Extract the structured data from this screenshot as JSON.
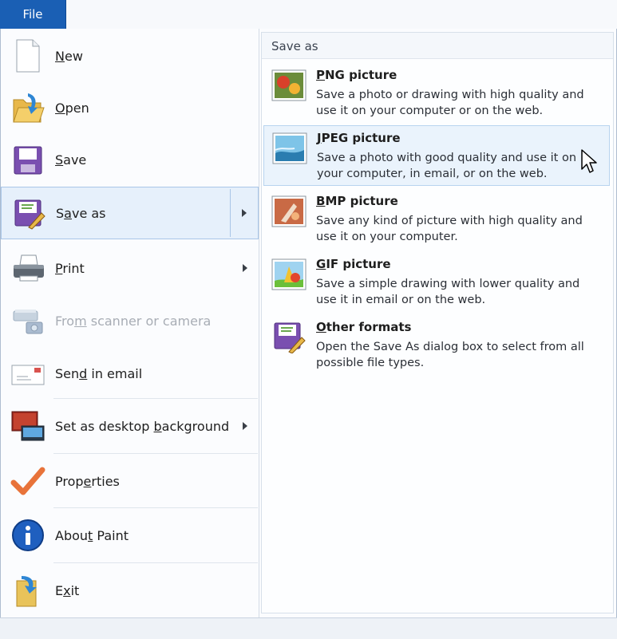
{
  "tab": {
    "file_label": "File"
  },
  "menu": {
    "items": [
      {
        "label": "New",
        "hotkey_letter": "N"
      },
      {
        "label": "Open",
        "hotkey_letter": "O"
      },
      {
        "label": "Save",
        "hotkey_letter": "S"
      },
      {
        "label": "Save as",
        "hotkey_letter": "a"
      },
      {
        "label": "Print",
        "hotkey_letter": "P"
      },
      {
        "label": "From scanner or camera",
        "hotkey_letter": "m"
      },
      {
        "label": "Send in email",
        "hotkey_letter": "d"
      },
      {
        "label": "Set as desktop background",
        "hotkey_letter": "b"
      },
      {
        "label": "Properties",
        "hotkey_letter": "e"
      },
      {
        "label": "About Paint",
        "hotkey_letter": "t"
      },
      {
        "label": "Exit",
        "hotkey_letter": "x"
      }
    ]
  },
  "save_as_panel": {
    "title": "Save as",
    "options": [
      {
        "title": "PNG picture",
        "desc": "Save a photo or drawing with high quality and use it on your computer or on the web."
      },
      {
        "title": "JPEG picture",
        "desc": "Save a photo with good quality and use it on your computer, in email, or on the web."
      },
      {
        "title": "BMP picture",
        "desc": "Save any kind of picture with high quality and use it on your computer."
      },
      {
        "title": "GIF picture",
        "desc": "Save a simple drawing with lower quality and use it in email or on the web."
      },
      {
        "title": "Other formats",
        "desc": "Open the Save As dialog box to select from all possible file types."
      }
    ]
  },
  "colors": {
    "accent": "#1a5fb4",
    "hover_bg": "#e6f0fb",
    "disabled_text": "#a8adb5"
  }
}
